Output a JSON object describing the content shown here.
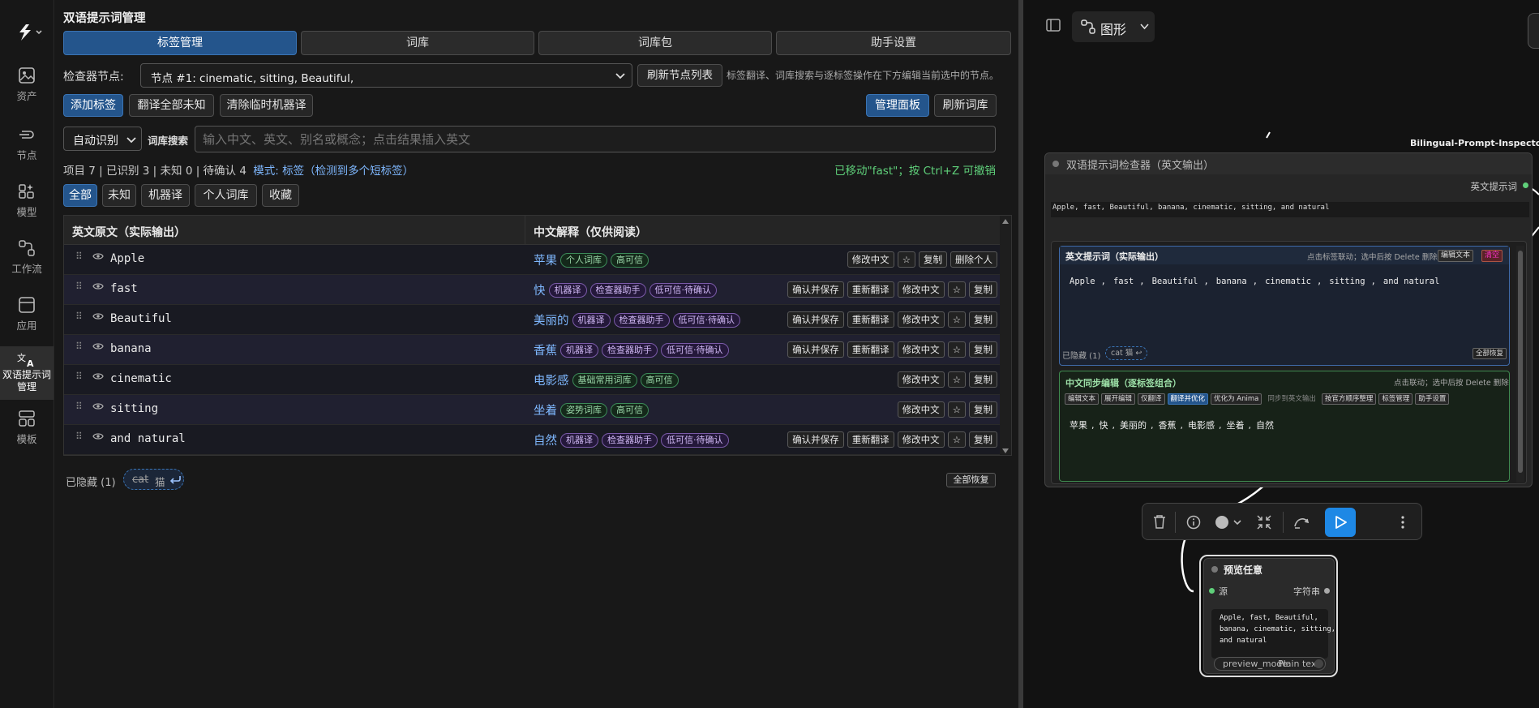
{
  "rail": {
    "items": [
      {
        "label": "资产"
      },
      {
        "label": "节点"
      },
      {
        "label": "模型"
      },
      {
        "label": "工作流"
      },
      {
        "label": "应用"
      },
      {
        "label": "双语提示词管理"
      },
      {
        "label": "模板"
      }
    ]
  },
  "panel": {
    "title": "双语提示词管理",
    "tabs": [
      "标签管理",
      "词库",
      "词库包",
      "助手设置"
    ],
    "inspector_label": "检查器节点:",
    "inspector_value": "节点 #1: cinematic, sitting, Beautiful,",
    "refresh_nodes": "刷新节点列表",
    "inspector_hint": "标签翻译、词库搜索与逐标签操作在下方编辑当前选中的节点。",
    "add_tag": "添加标签",
    "translate_unknown": "翻译全部未知",
    "clear_mt": "清除临时机器译",
    "manage_panel": "管理面板",
    "refresh_lexicon": "刷新词库",
    "auto_detect": "自动识别",
    "lexicon_search_label": "词库搜索",
    "search_placeholder": "输入中文、英文、别名或概念；点击结果插入英文",
    "stats": "项目 7 | 已识别 3 | 未知 0 | 待确认 4",
    "mode_label": "模式:",
    "mode_value": "标签（检测到多个短标签）",
    "moved_msg": "已移动\"fast\"；按 Ctrl+Z 可撤销",
    "filters": [
      "全部",
      "未知",
      "机器译",
      "个人词库",
      "收藏"
    ],
    "col_en": "英文原文（实际输出）",
    "col_cn": "中文解释（仅供阅读）",
    "rows": [
      {
        "en": "Apple",
        "cn": "苹果",
        "tags": [
          {
            "t": "个人词库",
            "c": "green"
          },
          {
            "t": "高可信",
            "c": "green"
          }
        ],
        "actions": [
          "修改中文",
          "☆",
          "复制",
          "删除个人"
        ]
      },
      {
        "en": "fast",
        "cn": "快",
        "tags": [
          {
            "t": "机器译",
            "c": "purple"
          },
          {
            "t": "检查器助手",
            "c": "purple"
          },
          {
            "t": "低可信·待确认",
            "c": "purple"
          }
        ],
        "actions": [
          "确认并保存",
          "重新翻译",
          "修改中文",
          "☆",
          "复制"
        ]
      },
      {
        "en": "Beautiful",
        "cn": "美丽的",
        "tags": [
          {
            "t": "机器译",
            "c": "purple"
          },
          {
            "t": "检查器助手",
            "c": "purple"
          },
          {
            "t": "低可信·待确认",
            "c": "purple"
          }
        ],
        "actions": [
          "确认并保存",
          "重新翻译",
          "修改中文",
          "☆",
          "复制"
        ]
      },
      {
        "en": "banana",
        "cn": "香蕉",
        "tags": [
          {
            "t": "机器译",
            "c": "purple"
          },
          {
            "t": "检查器助手",
            "c": "purple"
          },
          {
            "t": "低可信·待确认",
            "c": "purple"
          }
        ],
        "actions": [
          "确认并保存",
          "重新翻译",
          "修改中文",
          "☆",
          "复制"
        ]
      },
      {
        "en": "cinematic",
        "cn": "电影感",
        "tags": [
          {
            "t": "基础常用词库",
            "c": "green"
          },
          {
            "t": "高可信",
            "c": "green"
          }
        ],
        "actions": [
          "修改中文",
          "☆",
          "复制"
        ]
      },
      {
        "en": "sitting",
        "cn": "坐着",
        "tags": [
          {
            "t": "姿势词库",
            "c": "green"
          },
          {
            "t": "高可信",
            "c": "green"
          }
        ],
        "actions": [
          "修改中文",
          "☆",
          "复制"
        ]
      },
      {
        "en": "and natural",
        "cn": "自然",
        "tags": [
          {
            "t": "机器译",
            "c": "purple"
          },
          {
            "t": "检查器助手",
            "c": "purple"
          },
          {
            "t": "低可信·待确认",
            "c": "purple"
          }
        ],
        "actions": [
          "确认并保存",
          "重新翻译",
          "修改中文",
          "☆",
          "复制"
        ]
      }
    ],
    "hidden_label": "已隐藏 (1)",
    "hidden_chip_en": "cat",
    "hidden_chip_cn": "猫",
    "restore_all": "全部恢复"
  },
  "canvas": {
    "view_label": "图形",
    "node_title_tag": "Bilingual-Prompt-Inspector",
    "node_title": "双语提示词检查器（英文输出）",
    "output_label": "英文提示词",
    "output_text": "Apple, fast, Beautiful, banana, cinematic, sitting, and natural",
    "en_section_title": "英文提示词（实际输出）",
    "en_section_hint": "点击标签联动；选中后按 Delete 删除",
    "edit_text": "编辑文本",
    "clear": "清空",
    "en_tokens": [
      "Apple",
      "fast",
      "Beautiful",
      "banana",
      "cinematic",
      "sitting",
      "and natural"
    ],
    "en_sep": ",",
    "hidden_small": "已隐藏 (1)",
    "chip_small": "cat 猫",
    "restore_small": "全部恢复",
    "cn_section_title": "中文同步编辑（逐标签组合）",
    "cn_section_hint": "点击联动；选中后按 Delete 删除",
    "cn_buttons": [
      "编辑文本",
      "展开编辑",
      "仅翻译",
      "翻译并优化",
      "优化为 Anima",
      "同步到英文输出",
      "按官方顺序整理",
      "标签管理",
      "助手设置"
    ],
    "cn_tokens": [
      "苹果",
      "快",
      "美丽的",
      "香蕉",
      "电影感",
      "坐着",
      "自然"
    ],
    "preview_title": "预览任意",
    "preview_in": "源",
    "preview_out": "字符串",
    "preview_text": "Apple, fast, Beautiful,\nbanana, cinematic, sitting,\nand natural",
    "preview_mode_label": "preview_mode",
    "preview_mode_value": "Plain text"
  },
  "colors": {
    "accent": "#24558c",
    "run": "#1e88e5",
    "green_text": "#5fd07a"
  }
}
